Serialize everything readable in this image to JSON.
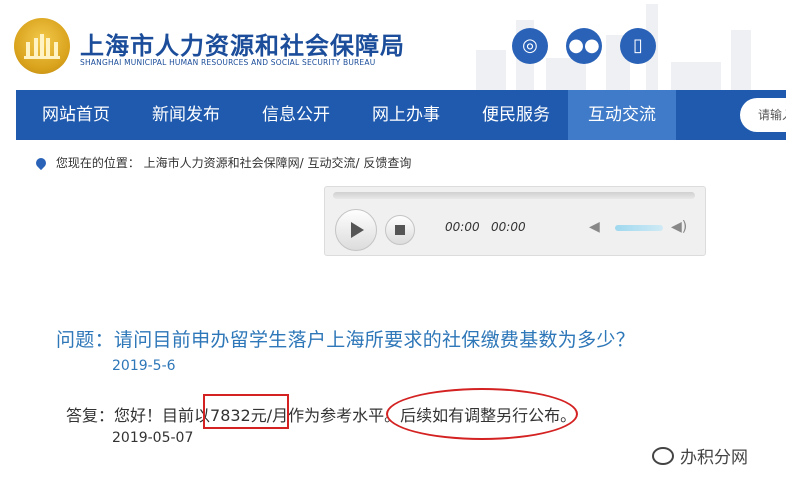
{
  "header": {
    "title": "上海市人力资源和社会保障局",
    "subtitle": "SHANGHAI MUNICIPAL HUMAN RESOURCES AND SOCIAL SECURITY BUREAU",
    "social": [
      "weibo-icon",
      "wechat-icon",
      "mobile-icon"
    ]
  },
  "nav": {
    "items": [
      {
        "label": "网站首页"
      },
      {
        "label": "新闻发布"
      },
      {
        "label": "信息公开"
      },
      {
        "label": "网上办事"
      },
      {
        "label": "便民服务"
      },
      {
        "label": "互动交流"
      }
    ],
    "active_label": "互动交流",
    "search_placeholder": "请输入"
  },
  "breadcrumb": {
    "label": "您现在的位置：",
    "items": [
      "上海市人力资源和社会保障网/",
      "互动交流/",
      "反馈查询"
    ]
  },
  "player": {
    "current_time": "00:00",
    "total_time": "00:00"
  },
  "qa": {
    "question": "问题：请问目前申办留学生落户上海所要求的社保缴费基数为多少？",
    "question_date": "2019-5-6",
    "answer_prefix": "答复：您好！目前以",
    "answer_amount": "7832元/月",
    "answer_middle": "作为参考水平。",
    "answer_suffix": "后续如有调整另行公布。",
    "answer_date": "2019-05-07"
  },
  "watermark": {
    "text": "办积分网"
  },
  "colors": {
    "brand_blue": "#1f5aae",
    "active_tab": "#3f7bc8",
    "question_blue": "#2e77b8",
    "annotation_red": "#d42222"
  }
}
